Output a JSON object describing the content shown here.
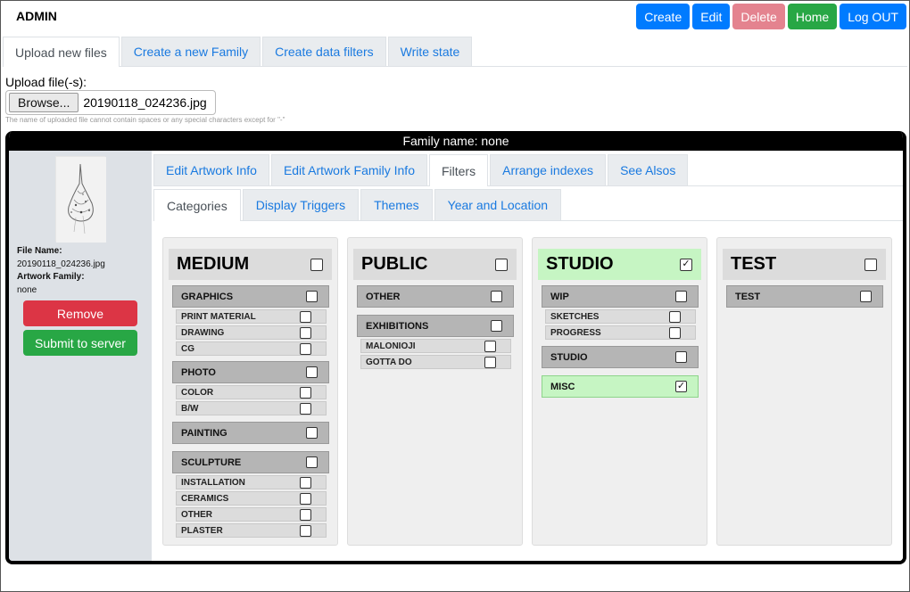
{
  "app": {
    "title": "ADMIN"
  },
  "top_buttons": [
    {
      "label": "Create",
      "color": "#007bff"
    },
    {
      "label": "Edit",
      "color": "#007bff"
    },
    {
      "label": "Delete",
      "color": "#e4838f"
    },
    {
      "label": "Home",
      "color": "#28a745"
    },
    {
      "label": "Log OUT",
      "color": "#007bff"
    }
  ],
  "main_tabs": [
    {
      "label": "Upload new files",
      "active": true
    },
    {
      "label": "Create a new Family",
      "active": false
    },
    {
      "label": "Create data filters",
      "active": false
    },
    {
      "label": "Write state",
      "active": false
    }
  ],
  "upload": {
    "label": "Upload file(-s):",
    "browse_label": "Browse...",
    "file_name": "20190118_024236.jpg",
    "hint": "The name of uploaded file cannot contain spaces or any special characters except for \"-\""
  },
  "family": {
    "title": "Family name: none",
    "file_name_label": "File Name:",
    "file_name_value": "20190118_024236.jpg",
    "artwork_family_label": "Artwork Family:",
    "artwork_family_value": "none",
    "remove_label": "Remove",
    "submit_label": "Submit to server"
  },
  "sub_tabs": [
    {
      "label": "Edit Artwork Info",
      "active": false
    },
    {
      "label": "Edit Artwork Family Info",
      "active": false
    },
    {
      "label": "Filters",
      "active": true
    },
    {
      "label": "Arrange indexes",
      "active": false
    },
    {
      "label": "See Alsos",
      "active": false
    }
  ],
  "filter_tabs": [
    {
      "label": "Categories",
      "active": true
    },
    {
      "label": "Display Triggers",
      "active": false
    },
    {
      "label": "Themes",
      "active": false
    },
    {
      "label": "Year and Location",
      "active": false
    }
  ],
  "columns": [
    {
      "name": "MEDIUM",
      "checked": false,
      "groups": [
        {
          "name": "GRAPHICS",
          "checked": false,
          "items": [
            {
              "name": "PRINT MATERIAL",
              "checked": false
            },
            {
              "name": "DRAWING",
              "checked": false
            },
            {
              "name": "CG",
              "checked": false
            }
          ]
        },
        {
          "name": "PHOTO",
          "checked": false,
          "items": [
            {
              "name": "COLOR",
              "checked": false
            },
            {
              "name": "B/W",
              "checked": false
            }
          ]
        },
        {
          "name": "PAINTING",
          "checked": false,
          "items": []
        },
        {
          "name": "SCULPTURE",
          "checked": false,
          "items": [
            {
              "name": "INSTALLATION",
              "checked": false
            },
            {
              "name": "CERAMICS",
              "checked": false
            },
            {
              "name": "OTHER",
              "checked": false
            },
            {
              "name": "PLASTER",
              "checked": false
            }
          ]
        }
      ]
    },
    {
      "name": "PUBLIC",
      "checked": false,
      "groups": [
        {
          "name": "OTHER",
          "checked": false,
          "items": []
        },
        {
          "name": "EXHIBITIONS",
          "checked": false,
          "items": [
            {
              "name": "MALONIOJI",
              "checked": false
            },
            {
              "name": "GOTTA DO",
              "checked": false
            }
          ]
        }
      ]
    },
    {
      "name": "STUDIO",
      "checked": true,
      "groups": [
        {
          "name": "WIP",
          "checked": false,
          "items": [
            {
              "name": "SKETCHES",
              "checked": false
            },
            {
              "name": "PROGRESS",
              "checked": false
            }
          ]
        },
        {
          "name": "STUDIO",
          "checked": false,
          "items": []
        },
        {
          "name": "MISC",
          "checked": true,
          "items": []
        }
      ]
    },
    {
      "name": "TEST",
      "checked": false,
      "groups": [
        {
          "name": "TEST",
          "checked": false,
          "items": []
        }
      ]
    }
  ],
  "colors": {
    "highlight": "#c6f5c3",
    "tab_text": "#1a7ae0",
    "family_bg": "#000000"
  }
}
